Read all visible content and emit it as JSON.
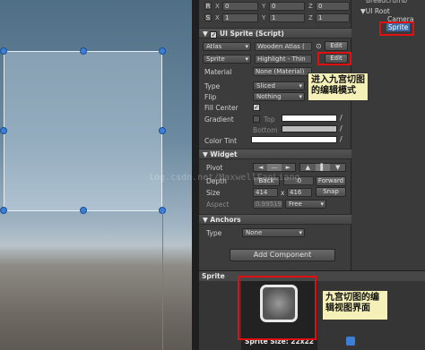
{
  "transform": {
    "rows": [
      {
        "button": "R",
        "x": "0",
        "y": "0",
        "z": "0"
      },
      {
        "button": "S",
        "x": "1",
        "y": "1",
        "z": "1"
      }
    ]
  },
  "component": {
    "title": "UI Sprite (Script)"
  },
  "atlas": {
    "dropdown": "Atlas",
    "value": "Wooden Atlas (",
    "edit": "Edit"
  },
  "sprite": {
    "dropdown": "Sprite",
    "value": "Highlight - Thin",
    "edit": "Edit"
  },
  "material": {
    "label": "Material",
    "value": "None (Material)"
  },
  "type": {
    "label": "Type",
    "value": "Sliced"
  },
  "flip": {
    "label": "Flip",
    "value": "Nothing"
  },
  "fill_center": {
    "label": "Fill Center",
    "checked": "✓"
  },
  "gradient": {
    "label": "Gradient",
    "top": "Top",
    "bottom": "Bottom"
  },
  "color_tint": {
    "label": "Color Tint"
  },
  "widget": {
    "header": "Widget",
    "pivot_label": "Pivot",
    "depth_label": "Depth",
    "back": "Back",
    "depth_value": "0",
    "forward": "Forward",
    "size_label": "Size",
    "width": "414",
    "x": "x",
    "height": "416",
    "snap": "Snap",
    "aspect_label": "Aspect",
    "aspect_value": "0.99519",
    "aspect_mode": "Free"
  },
  "anchors": {
    "header": "Anchors",
    "type_label": "Type",
    "type_value": "None"
  },
  "add_component": "Add Component",
  "hierarchy": {
    "items": [
      "UI Root",
      "Camera",
      "Sprite"
    ]
  },
  "preview": {
    "title": "Sprite",
    "size_text": "Sprite Size: 22x22"
  },
  "annotations": {
    "edit_note_line1": "进入九宫切图",
    "edit_note_line2": "的编辑模式",
    "preview_note_line1": "九宫切图的编",
    "preview_note_line2": "辑视图界面"
  },
  "watermark": "log.csdn.net/MaxwellFanLiang",
  "colors": {
    "annotation_bg": "#f4f0b8",
    "highlight_red": "#e01010",
    "handle_blue": "#3c7fd6"
  }
}
